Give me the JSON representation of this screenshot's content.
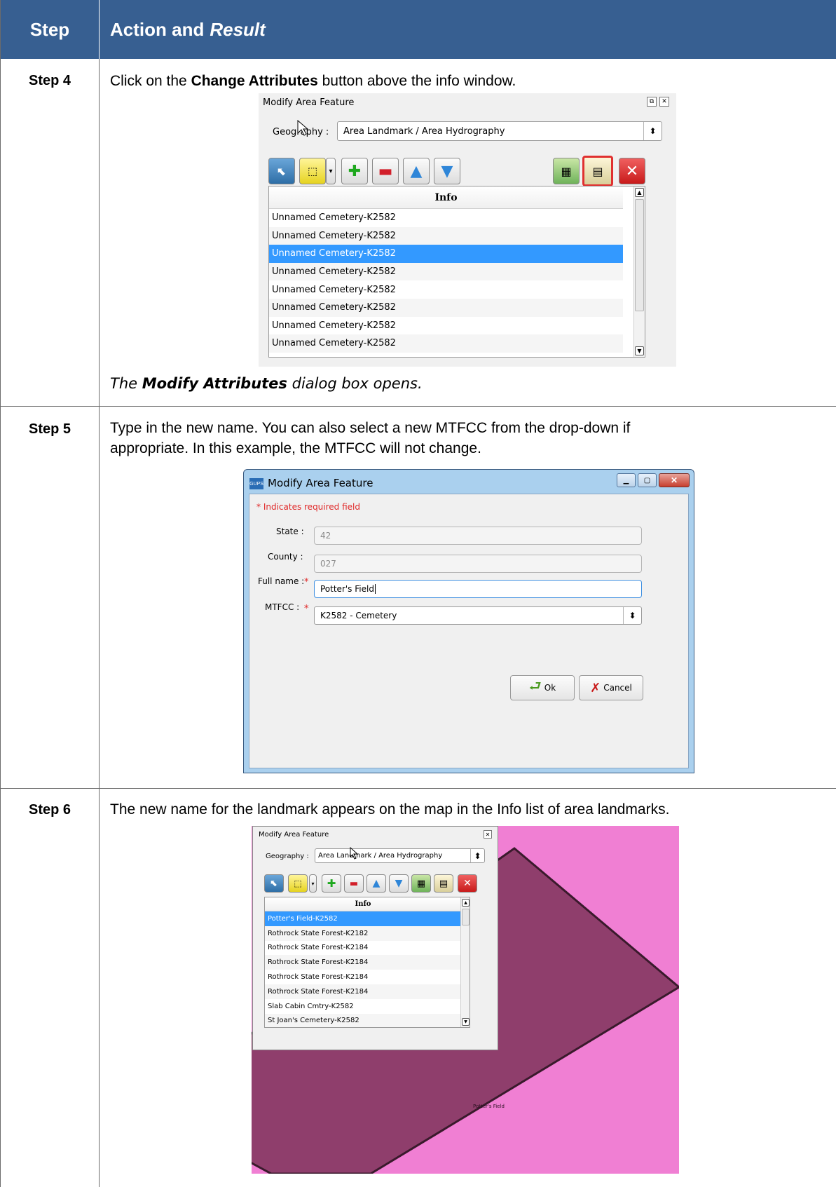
{
  "header": {
    "step": "Step",
    "action": "Action and",
    "result_word": "Result"
  },
  "step4": {
    "label": "Step 4",
    "text_before": "Click on the ",
    "text_bold": "Change Attributes",
    "text_after": " button above the info window.",
    "panel": {
      "title": "Modify Area Feature",
      "geo_label": "Geography :",
      "geo_value": "Area Landmark / Area Hydrography",
      "info_header": "Info",
      "rows": [
        "Unnamed Cemetery-K2582",
        "Unnamed Cemetery-K2582",
        "Unnamed Cemetery-K2582",
        "Unnamed Cemetery-K2582",
        "Unnamed Cemetery-K2582",
        "Unnamed Cemetery-K2582",
        "Unnamed Cemetery-K2582",
        "Unnamed Cemetery-K2582"
      ],
      "selected_row": 2
    },
    "result_prefix": "The ",
    "result_bold": "Modify Attributes",
    "result_suffix": " dialog box opens."
  },
  "step5": {
    "label": "Step 5",
    "text_line1": "Type in the new name. You can also select a new MTFCC from the drop-down if",
    "text_line2": "appropriate. In this example, the MTFCC will not change.",
    "dialog": {
      "app_icon": "GUPS",
      "title": "Modify Area Feature",
      "required_note": "* Indicates required field",
      "state_label": "State :",
      "state_value": "42",
      "county_label": "County :",
      "county_value": "027",
      "fullname_label": "Full name :",
      "fullname_value": "Potter's Field",
      "mtfcc_label": "MTFCC :",
      "mtfcc_value": "K2582 - Cemetery",
      "required_star": "*",
      "ok_label": "Ok",
      "cancel_label": "Cancel"
    }
  },
  "step6": {
    "label": "Step 6",
    "text": "The new name for the landmark appears on the map in the Info list of area landmarks.",
    "panel": {
      "title": "Modify Area Feature",
      "geo_label": "Geography :",
      "geo_value": "Area Landmark / Area Hydrography",
      "info_header": "Info",
      "rows": [
        "Potter's Field-K2582",
        "Rothrock State Forest-K2182",
        "Rothrock State Forest-K2184",
        "Rothrock State Forest-K2184",
        "Rothrock State Forest-K2184",
        "Rothrock State Forest-K2184",
        "Slab Cabin Cmtry-K2582",
        "St Joan's Cemetery-K2582"
      ],
      "selected_row": 0
    },
    "map_label": "Potter's Field",
    "colors": {
      "map_bg": "#f07fd3",
      "polygon": "#8f3e6c"
    }
  },
  "colors": {
    "header_bg": "#375f91",
    "selection": "#3399ff",
    "highlight_border": "#e03030"
  }
}
